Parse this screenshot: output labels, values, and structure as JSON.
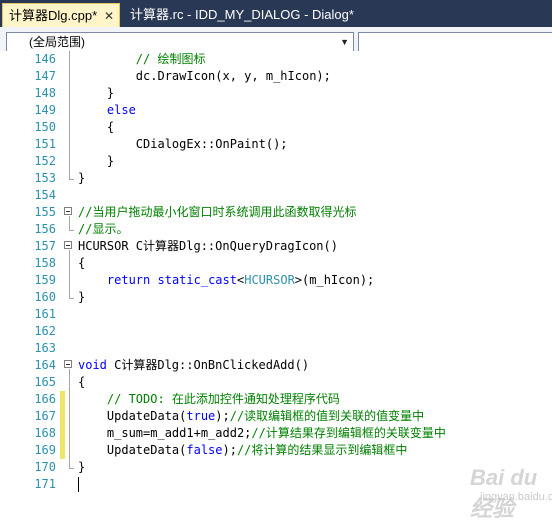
{
  "tabs": [
    {
      "label": "计算器Dlg.cpp*",
      "close": "✕",
      "active": true
    },
    {
      "label": "计算器.rc - IDD_MY_DIALOG - Dialog*",
      "active": false
    }
  ],
  "scope": {
    "value": "(全局范围)"
  },
  "lines": [
    {
      "n": "146",
      "segs": [
        [
          "",
          "        "
        ],
        [
          "cm",
          "// 绘制图标"
        ]
      ]
    },
    {
      "n": "147",
      "segs": [
        [
          "",
          "        dc.DrawIcon(x, y, m_hIcon);"
        ]
      ]
    },
    {
      "n": "148",
      "segs": [
        [
          "",
          "    }"
        ]
      ]
    },
    {
      "n": "149",
      "segs": [
        [
          "",
          "    "
        ],
        [
          "kw",
          "else"
        ]
      ]
    },
    {
      "n": "150",
      "segs": [
        [
          "",
          "    {"
        ]
      ]
    },
    {
      "n": "151",
      "segs": [
        [
          "",
          "        CDialogEx::OnPaint();"
        ]
      ]
    },
    {
      "n": "152",
      "segs": [
        [
          "",
          "    }"
        ]
      ]
    },
    {
      "n": "153",
      "segs": [
        [
          "",
          "}"
        ]
      ]
    },
    {
      "n": "154",
      "segs": [
        [
          "",
          ""
        ]
      ]
    },
    {
      "n": "155",
      "segs": [
        [
          "cm",
          "//当用户拖动最小化窗口时系统调用此函数取得光标"
        ]
      ]
    },
    {
      "n": "156",
      "segs": [
        [
          "cm",
          "//显示。"
        ]
      ]
    },
    {
      "n": "157",
      "segs": [
        [
          "",
          "HCURSOR C计算器Dlg::OnQueryDragIcon()"
        ]
      ]
    },
    {
      "n": "158",
      "segs": [
        [
          "",
          "{"
        ]
      ]
    },
    {
      "n": "159",
      "segs": [
        [
          "",
          "    "
        ],
        [
          "kw",
          "return"
        ],
        [
          "",
          " "
        ],
        [
          "kw",
          "static_cast"
        ],
        [
          "",
          "<"
        ],
        [
          "ty",
          "HCURSOR"
        ],
        [
          "",
          ">(m_hIcon);"
        ]
      ]
    },
    {
      "n": "160",
      "segs": [
        [
          "",
          "}"
        ]
      ]
    },
    {
      "n": "161",
      "segs": [
        [
          "",
          ""
        ]
      ]
    },
    {
      "n": "162",
      "segs": [
        [
          "",
          ""
        ]
      ]
    },
    {
      "n": "163",
      "segs": [
        [
          "",
          ""
        ]
      ]
    },
    {
      "n": "164",
      "segs": [
        [
          "kw",
          "void"
        ],
        [
          "",
          " C计算器Dlg::OnBnClickedAdd()"
        ]
      ]
    },
    {
      "n": "165",
      "segs": [
        [
          "",
          "{"
        ]
      ]
    },
    {
      "n": "166",
      "segs": [
        [
          "",
          "    "
        ],
        [
          "cm",
          "// TODO: 在此添加控件通知处理程序代码"
        ]
      ]
    },
    {
      "n": "167",
      "segs": [
        [
          "",
          "    UpdateData("
        ],
        [
          "kw",
          "true"
        ],
        [
          "",
          ");"
        ],
        [
          "cm",
          "//读取编辑框的值到关联的值变量中"
        ]
      ]
    },
    {
      "n": "168",
      "segs": [
        [
          "",
          "    m_sum=m_add1+m_add2;"
        ],
        [
          "cm",
          "//计算结果存到编辑框的关联变量中"
        ]
      ]
    },
    {
      "n": "169",
      "segs": [
        [
          "",
          "    UpdateData("
        ],
        [
          "kw",
          "false"
        ],
        [
          "",
          ");"
        ],
        [
          "cm",
          "//将计算的结果显示到编辑框中"
        ]
      ]
    },
    {
      "n": "170",
      "segs": [
        [
          "",
          "}"
        ]
      ]
    },
    {
      "n": "171",
      "segs": [
        [
          "",
          ""
        ]
      ]
    }
  ],
  "watermark": {
    "logo": "Bai du 经验",
    "sub": "jingyan.baidu.com"
  }
}
